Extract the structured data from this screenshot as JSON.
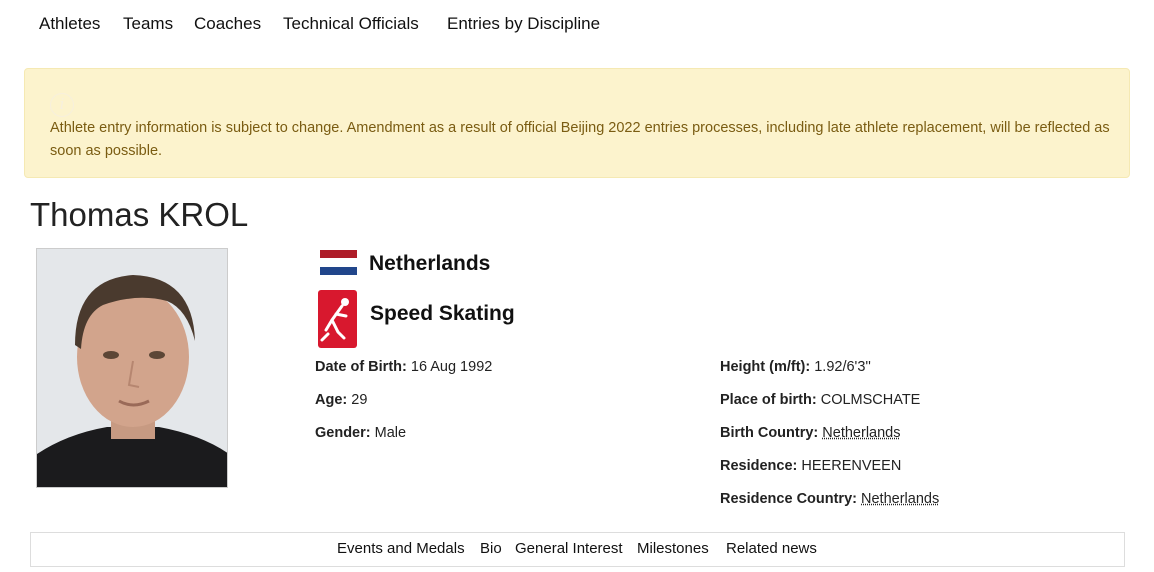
{
  "top_nav": {
    "athletes": "Athletes",
    "teams": "Teams",
    "coaches": "Coaches",
    "technical_officials": "Technical Officials",
    "entries_by_discipline": "Entries by Discipline"
  },
  "notice": {
    "icon": "info-icon",
    "message": "Athlete entry information is subject to change. Amendment as a result of official Beijing 2022 entries processes, including late athlete replacement, will be reflected as soon as possible."
  },
  "athlete": {
    "name": "Thomas KROL",
    "country": "Netherlands",
    "sport": "Speed Skating",
    "flag_colors": [
      "#ae1c28",
      "#ffffff",
      "#21468b"
    ],
    "sport_color": "#d8182e"
  },
  "details_left": {
    "dob_label": "Date of Birth:",
    "dob_value": "16 Aug 1992",
    "age_label": "Age:",
    "age_value": "29",
    "gender_label": "Gender:",
    "gender_value": "Male"
  },
  "details_right": {
    "height_label": "Height (m/ft):",
    "height_value": "1.92/6'3''",
    "place_label": "Place of birth:",
    "place_value": "COLMSCHATE",
    "birth_country_label": "Birth Country:",
    "birth_country_value": "Netherlands",
    "residence_label": "Residence:",
    "residence_value": "HEERENVEEN",
    "residence_country_label": "Residence Country:",
    "residence_country_value": "Netherlands"
  },
  "bottom_nav": {
    "events_medals": "Events and Medals",
    "bio": "Bio",
    "general_interest": "General Interest",
    "milestones": "Milestones",
    "related_news": "Related news"
  }
}
